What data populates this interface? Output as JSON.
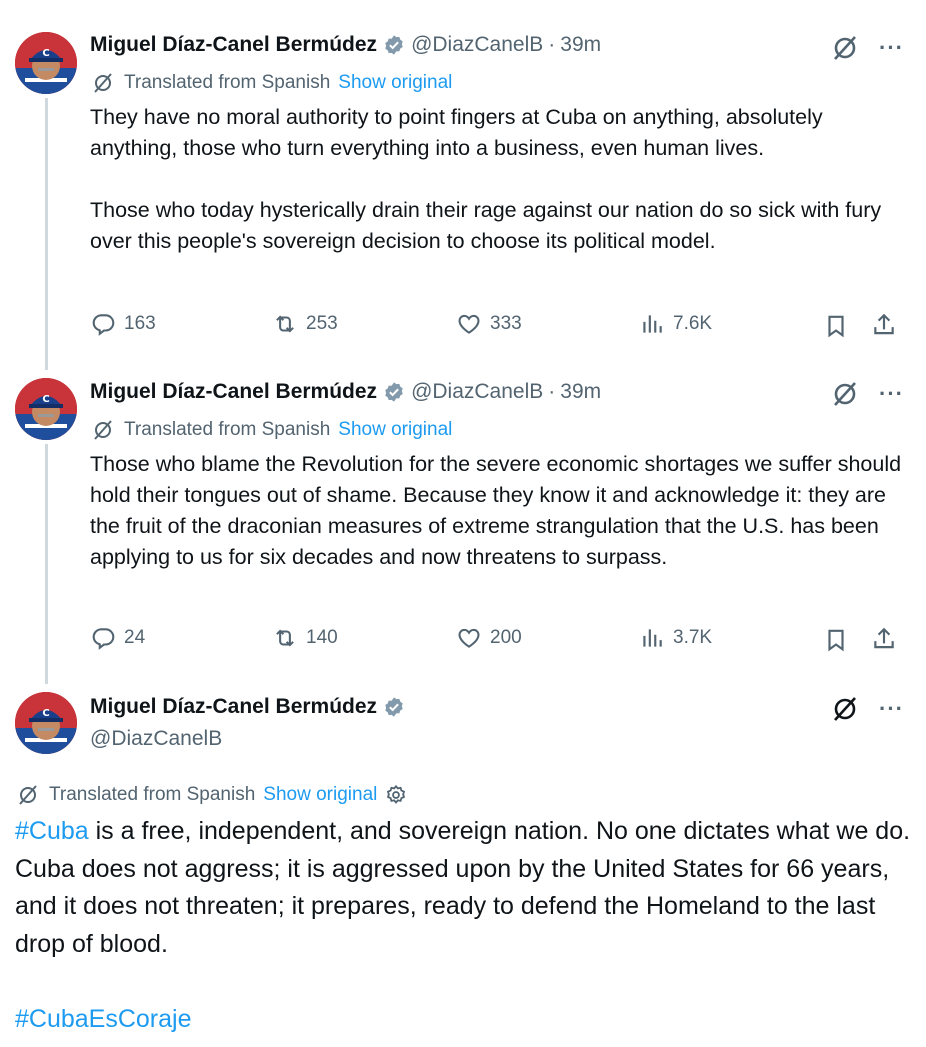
{
  "tweets": [
    {
      "name": "Miguel Díaz-Canel Bermúdez",
      "handle": "@DiazCanelB",
      "separator": "·",
      "time": "39m",
      "translated_label": "Translated from Spanish",
      "show_original": "Show original",
      "text": "They have no moral authority to point fingers at Cuba on anything, absolutely anything, those who turn everything into a business, even human lives.\n\nThose who today hysterically drain their rage against our nation do so sick with fury over this people's sovereign decision to choose its political model.",
      "replies": "163",
      "reposts": "253",
      "likes": "333",
      "views": "7.6K"
    },
    {
      "name": "Miguel Díaz-Canel Bermúdez",
      "handle": "@DiazCanelB",
      "separator": "·",
      "time": "39m",
      "translated_label": "Translated from Spanish",
      "show_original": "Show original",
      "text": "Those who blame the Revolution for the severe economic shortages we suffer should hold their tongues out of shame. Because they know it and acknowledge it: they are the fruit of the draconian measures of extreme strangulation that the U.S. has been applying to us for six decades and now threatens to surpass.",
      "replies": "24",
      "reposts": "140",
      "likes": "200",
      "views": "3.7K"
    }
  ],
  "main_tweet": {
    "name": "Miguel Díaz-Canel Bermúdez",
    "handle": "@DiazCanelB",
    "translated_label": "Translated from Spanish",
    "show_original": "Show original",
    "hashtag1": "#Cuba",
    "text": " is a free, independent, and sovereign nation. No one dictates what we do. Cuba does not aggress; it is aggressed upon by the United States for 66 years, and it does not threaten; it prepares, ready to defend the Homeland to the last drop of blood.",
    "hashtag2": "#CubaEsCoraje"
  },
  "more_label": "···",
  "colors": {
    "accent": "#1d9bf0",
    "muted": "#536471",
    "text": "#0f1419",
    "thread_line": "#cfd9de"
  },
  "icons": [
    "verified-badge-icon",
    "grok-translate-icon",
    "more-icon",
    "reply-icon",
    "repost-icon",
    "like-icon",
    "views-icon",
    "bookmark-icon",
    "share-icon",
    "settings-gear-icon"
  ]
}
